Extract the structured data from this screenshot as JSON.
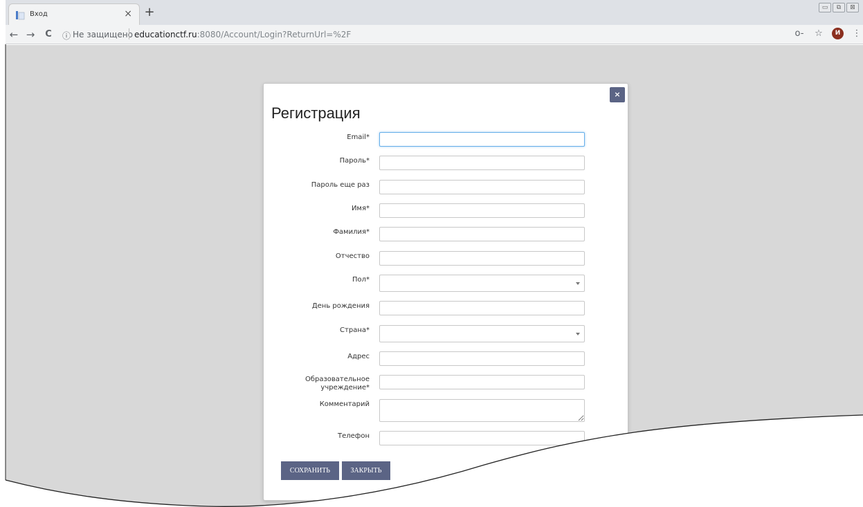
{
  "browser": {
    "tab_title": "Вход",
    "tab_close": "×",
    "new_tab": "+",
    "win_minimize": "▭",
    "win_restore": "⧉",
    "win_close": "⊠",
    "nav_back": "←",
    "nav_forward": "→",
    "nav_reload": "C",
    "info_icon": "ⓘ",
    "security_text": "Не защищено",
    "url_host": "educationctf.ru",
    "url_rest": ":8080/Account/Login?ReturnUrl=%2F",
    "key_icon": "o-",
    "star_icon": "☆",
    "avatar_letter": "И",
    "menu_icon": "⋮"
  },
  "modal": {
    "close_label": "×",
    "title": "Регистрация",
    "fields": [
      {
        "label": "Email*"
      },
      {
        "label": "Пароль*"
      },
      {
        "label": "Пароль еще раз"
      },
      {
        "label": "Имя*"
      },
      {
        "label": "Фамилия*"
      },
      {
        "label": "Отчество"
      },
      {
        "label": "Пол*"
      },
      {
        "label": "День рождения"
      },
      {
        "label": "Страна*"
      },
      {
        "label": "Адрес"
      },
      {
        "label_line1": "Образовательное",
        "label_line2": "учреждение*"
      },
      {
        "label": "Комментарий"
      },
      {
        "label": "Телефон"
      }
    ],
    "save_label": "СОХРАНИТЬ",
    "cancel_label": "ЗАКРЫТЬ"
  },
  "colors": {
    "accent": "#5b6485",
    "page_bg": "#d8d8d8"
  }
}
